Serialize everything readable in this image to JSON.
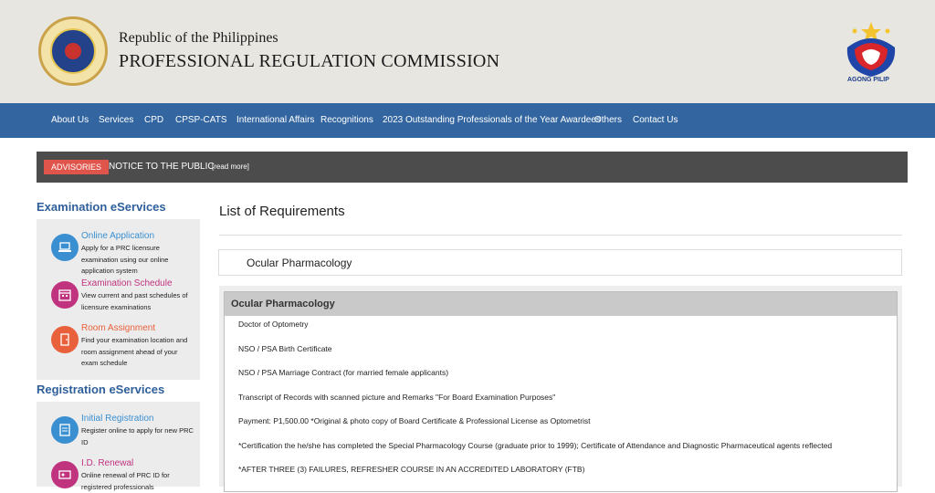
{
  "header": {
    "republic": "Republic of the Philippines",
    "title": "PROFESSIONAL REGULATION COMMISSION",
    "seal_icon": "prc-seal-logo",
    "right_logo_icon": "bagong-pilipinas-logo",
    "right_logo_text": "AGONG PILIP"
  },
  "nav": {
    "items": [
      "About Us",
      "Services",
      "CPD",
      "CPSP-CATS",
      "International Affairs",
      "Recognitions",
      "2023 Outstanding Professionals of the Year Awardees",
      "Others",
      "Contact Us"
    ]
  },
  "advisory": {
    "badge": "ADVISORIES",
    "notice": "NOTICE TO THE PUBLIC",
    "read_more": "[read more]"
  },
  "sidebar": {
    "exam_heading": "Examination eServices",
    "exam_items": [
      {
        "title": "Online Application",
        "desc": "Apply for a PRC licensure examination using our online application system",
        "color": "#3a8fd1",
        "icon": "laptop-icon"
      },
      {
        "title": "Examination Schedule",
        "desc": "View current and past schedules of licensure examinations",
        "color": "#c0337f",
        "icon": "calendar-icon"
      },
      {
        "title": "Room Assignment",
        "desc": "Find your examination location and room assignment ahead of your exam schedule",
        "color": "#e8613c",
        "icon": "door-icon"
      }
    ],
    "reg_heading": "Registration eServices",
    "reg_items": [
      {
        "title": "Initial Registration",
        "desc": "Register online to apply for new PRC ID",
        "color": "#3a8fd1",
        "icon": "id-card-icon"
      },
      {
        "title": "I.D. Renewal",
        "desc": "Online renewal of PRC ID for registered professionals",
        "color": "#c0337f",
        "icon": "renew-card-icon"
      }
    ]
  },
  "main": {
    "title": "List of Requirements",
    "subject": "Ocular Pharmacology",
    "panel_title": "Ocular Pharmacology",
    "requirements": [
      "Doctor of Optometry",
      "NSO / PSA Birth Certificate",
      "NSO / PSA Marriage Contract (for married female applicants)",
      "Transcript of Records with scanned picture and Remarks \"For Board Examination Purposes\"",
      "Payment: P1,500.00 *Original & photo copy of Board Certificate & Professional License as Optometrist",
      "*Certification the he/she has completed the Special Pharmacology Course (graduate prior to 1999); Certificate of Attendance and Diagnostic Pharmaceutical agents reflected",
      "*AFTER THREE (3) FAILURES, REFRESHER COURSE IN AN ACCREDITED LABORATORY (FTB)"
    ]
  },
  "colors": {
    "header_bg": "#e8e6e0",
    "nav_bg": "#3366a0",
    "advisory_bg": "#4c4c4c",
    "badge_bg": "#e0554b",
    "heading_blue": "#2f5f9a"
  }
}
